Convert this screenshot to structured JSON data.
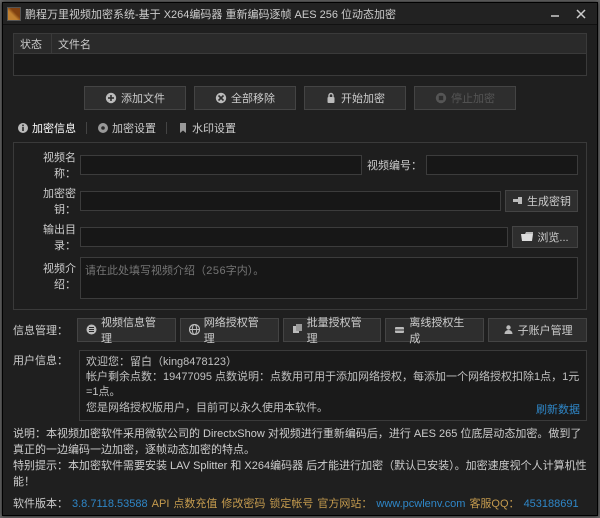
{
  "titlebar": {
    "title": "鹏程万里视频加密系统-基于 X264编码器 重新编码逐帧 AES 256 位动态加密"
  },
  "file_table": {
    "col_status": "状态",
    "col_name": "文件名"
  },
  "actions": {
    "add_file": "添加文件",
    "remove_all": "全部移除",
    "start_encrypt": "开始加密",
    "stop_encrypt": "停止加密"
  },
  "tabs": {
    "info": "加密信息",
    "settings": "加密设置",
    "watermark": "水印设置"
  },
  "form": {
    "video_name": "视频名称：",
    "video_number": "视频编号：",
    "encrypt_key": "加密密钥：",
    "gen_key_btn": "生成密钥",
    "output_dir": "输出目录：",
    "browse_btn": "浏览...",
    "video_desc": "视频介绍：",
    "desc_placeholder": "请在此处填写视频介绍（256字内）。"
  },
  "mgmt": {
    "label": "信息管理：",
    "video_info": "视频信息管理",
    "net_auth": "网络授权管理",
    "batch_auth": "批量授权管理",
    "offline_auth": "离线授权生成",
    "sub_account": "子账户管理"
  },
  "user": {
    "label": "用户信息：",
    "line1": "欢迎您：留白（king8478123）",
    "line2": "帐户剩余点数：19477095    点数说明：点数用可用于添加网络授权，每添加一个网络授权扣除1点，1元=1点。",
    "line3": "您是网络授权版用户，目前可以永久使用本软件。",
    "refresh": "刷新数据"
  },
  "desc": {
    "line1": "说明：本视频加密软件采用微软公司的 DirectxShow 对视频进行重新编码后，进行 AES 265 位底层动态加密。做到了真正的一边编码一边加密，逐帧动态加密的特点。",
    "line2": "特别提示：本加密软件需要安装 LAV Splitter 和 X264编码器 后才能进行加密（默认已安装）。加密速度视个人计算机性能！"
  },
  "footer": {
    "version_label": "软件版本：",
    "version": "3.8.7118.53588",
    "api": "API",
    "recharge": "点数充值",
    "change_pwd": "修改密码",
    "lock_account": "锁定帐号",
    "site_label": "官方网站：",
    "site": "www.pcwlenv.com",
    "qq_label": "客服QQ：",
    "qq": "453188691"
  }
}
